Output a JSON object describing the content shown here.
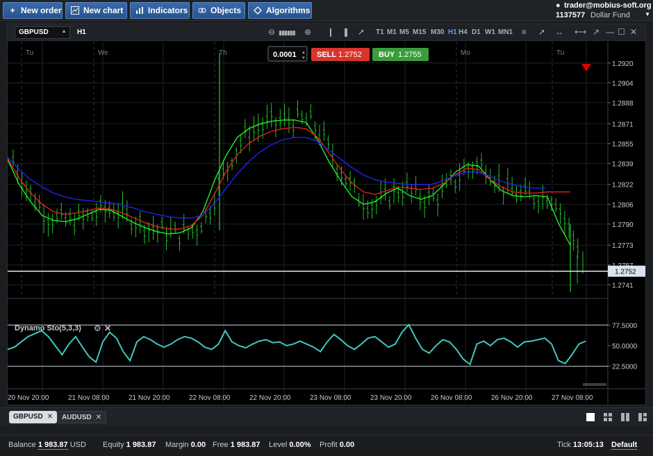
{
  "toolbar": {
    "new_order": "New order",
    "new_chart": "New chart",
    "indicators": "Indicators",
    "objects": "Objects",
    "algorithms": "Algorithms"
  },
  "account": {
    "user": "trader@mobius-soft.org",
    "number": "1137577",
    "fund": "Dollar Fund"
  },
  "chart": {
    "symbol": "GBPUSD",
    "timeframe": "H1",
    "timeframes": [
      "T1",
      "M1",
      "M5",
      "M15",
      "M30",
      "H1",
      "H4",
      "D1",
      "W1",
      "MN1"
    ],
    "active_timeframe": "H1",
    "quantity": "0.0001",
    "sell_label": "SELL",
    "sell_price": "1.2752",
    "buy_label": "BUY",
    "buy_price": "1.2755",
    "current_price_label": "1.2752",
    "day_labels": [
      "Tu",
      "We",
      "Th",
      "Mo",
      "Tu"
    ],
    "indicator_title": "Dynamo Sto(5,3,3)",
    "colors": {
      "candle": "#22c02a",
      "ma_fast": "#22ee22",
      "ma_mid": "#e02020",
      "ma_slow": "#2222ee",
      "oscillator": "#3fc8c0",
      "sell": "#d9342b",
      "buy": "#3c9c3c",
      "accent": "#5aa0ff"
    }
  },
  "chart_data": {
    "type": "line",
    "symbol": "GBPUSD",
    "x_tick_labels": [
      "20 Nov 20:00",
      "21 Nov 08:00",
      "21 Nov 20:00",
      "22 Nov 08:00",
      "22 Nov 20:00",
      "23 Nov 08:00",
      "23 Nov 20:00",
      "26 Nov 08:00",
      "26 Nov 20:00",
      "27 Nov 08:00"
    ],
    "y_tick_labels": [
      "1.2920",
      "1.2904",
      "1.2888",
      "1.2871",
      "1.2855",
      "1.2839",
      "1.2822",
      "1.2806",
      "1.2790",
      "1.2773",
      "1.2757",
      "1.2741"
    ],
    "ylim": [
      1.273,
      1.2935
    ],
    "grid": true,
    "series": [
      {
        "values": [
          1.2842,
          1.2822,
          1.2808,
          1.2797,
          1.2793,
          1.2792,
          1.2794,
          1.2798,
          1.2802,
          1.2801,
          1.2796,
          1.2791,
          1.2787,
          1.2784,
          1.2782,
          1.2783,
          1.2787,
          1.28,
          1.2825,
          1.2845,
          1.286,
          1.2867,
          1.2871,
          1.2873,
          1.2874,
          1.2874,
          1.2872,
          1.2858,
          1.284,
          1.2825,
          1.2812,
          1.2806,
          1.2808,
          1.2815,
          1.2819,
          1.2813,
          1.281,
          1.2813,
          1.2822,
          1.2832,
          1.2838,
          1.2837,
          1.2826,
          1.2817,
          1.2813,
          1.2812,
          1.2813,
          1.2812,
          1.279,
          1.2773
        ]
      },
      {
        "values": [
          1.2843,
          1.2827,
          1.2815,
          1.2806,
          1.28,
          1.2798,
          1.2799,
          1.2801,
          1.2803,
          1.2802,
          1.2799,
          1.2795,
          1.2791,
          1.2788,
          1.2786,
          1.2786,
          1.2789,
          1.2797,
          1.2814,
          1.2832,
          1.2846,
          1.2855,
          1.2861,
          1.2865,
          1.2867,
          1.2868,
          1.2867,
          1.286,
          1.2847,
          1.2834,
          1.2823,
          1.2816,
          1.2814,
          1.2817,
          1.282,
          1.2819,
          1.2818,
          1.2819,
          1.2823,
          1.283,
          1.2835,
          1.2834,
          1.2826,
          1.282,
          1.2816,
          1.2815,
          1.2815,
          1.2816,
          1.2816,
          1.2816
        ]
      },
      {
        "values": [
          1.2844,
          1.2834,
          1.2826,
          1.282,
          1.2815,
          1.2812,
          1.281,
          1.2809,
          1.2808,
          1.2807,
          1.2805,
          1.2803,
          1.28,
          1.2798,
          1.2796,
          1.2795,
          1.2795,
          1.2797,
          1.2806,
          1.2818,
          1.283,
          1.284,
          1.2848,
          1.2854,
          1.2858,
          1.286,
          1.286,
          1.2857,
          1.285,
          1.2843,
          1.2836,
          1.283,
          1.2826,
          1.2824,
          1.2823,
          1.2822,
          1.2822,
          1.2822,
          1.2825,
          1.2829,
          1.2832,
          1.2832,
          1.2829,
          1.2825,
          1.2822,
          1.282,
          1.2819,
          1.2819
        ]
      }
    ],
    "oscillator": {
      "name": "Dynamo Sto(5,3,3)",
      "levels": [
        77.5,
        50.0,
        22.5
      ],
      "y_tick_labels": [
        "77.5000",
        "50.0000",
        "22.5000"
      ],
      "ylim": [
        0,
        100
      ],
      "values": [
        45,
        48,
        55,
        62,
        66,
        70,
        62,
        50,
        38,
        52,
        62,
        48,
        35,
        28,
        55,
        68,
        60,
        42,
        30,
        55,
        62,
        58,
        52,
        48,
        52,
        58,
        62,
        60,
        55,
        48,
        45,
        52,
        70,
        55,
        50,
        47,
        52,
        56,
        58,
        54,
        55,
        50,
        52,
        56,
        52,
        48,
        42,
        55,
        65,
        58,
        50,
        45,
        52,
        60,
        62,
        55,
        48,
        52,
        68,
        78,
        60,
        45,
        40,
        50,
        58,
        55,
        45,
        32,
        25,
        52,
        56,
        50,
        58,
        60,
        55,
        48,
        55,
        56,
        58,
        60,
        52,
        30,
        26,
        38,
        52,
        56
      ]
    },
    "current_price": 1.2752
  }
}
